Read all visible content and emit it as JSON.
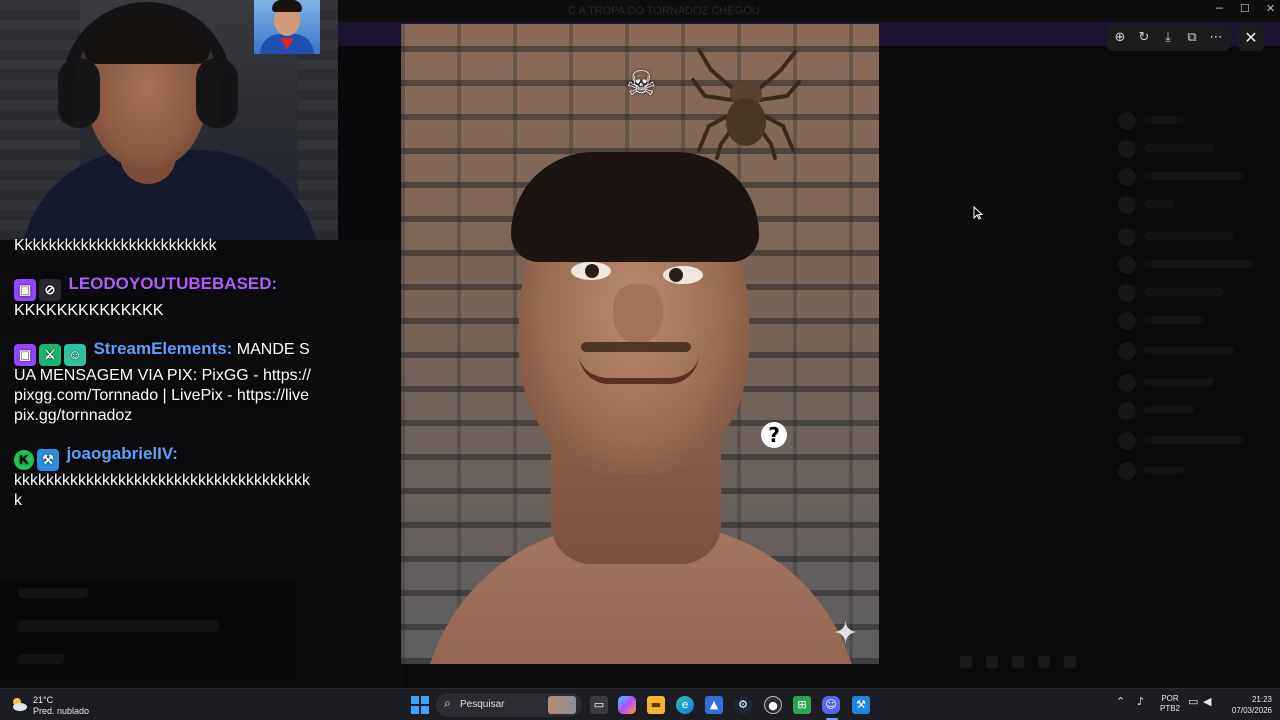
{
  "window": {
    "title": "C A TROPA DO TORNADOZ CHEGOU"
  },
  "viewer": {
    "toolbar": [
      {
        "name": "zoom-in-icon",
        "glyph": "⊕"
      },
      {
        "name": "rotate-icon",
        "glyph": "↻"
      },
      {
        "name": "download-icon",
        "glyph": "⤓"
      },
      {
        "name": "open-external-icon",
        "glyph": "⧉"
      },
      {
        "name": "more-icon",
        "glyph": "⋯"
      }
    ],
    "close_glyph": "✕",
    "stickers": {
      "skull": "☠",
      "question": "?",
      "sparkle": "✦"
    }
  },
  "chat": {
    "first_line": "Kkkkkkkkkkkkkkkkkkkkkkkkk",
    "messages": [
      {
        "badges": [
          "twitch-icon",
          "no-audio-icon"
        ],
        "user": "LEODOYOUTUBEBASED:",
        "user_color": "#b35cff",
        "text": "KKKKKKKKKKKKKK"
      },
      {
        "badges": [
          "twitch-icon",
          "moderator-icon",
          "bot-icon"
        ],
        "user": "StreamElements:",
        "user_color": "#5aa2ff",
        "text": " MANDE SUA MENSAGEM VIA PIX: PixGG - https://pixgg.com/Tornnado | LivePix - https://livepix.gg/tornnadoz"
      },
      {
        "badges": [
          "kick-icon",
          "hammer-icon"
        ],
        "user": "joaogabrielIV:",
        "user_color": "#5aa2ff",
        "text": "kkkkkkkkkkkkkkkkkkkkkkkkkkkkkkkkkkkkkk"
      }
    ]
  },
  "taskbar": {
    "weather_temp": "21°C",
    "weather_desc": "Pred. nublado",
    "search_placeholder": "Pesquisar",
    "lang_line1": "POR",
    "lang_line2": "PTB2",
    "time": "21:23",
    "date": "07/03/2026",
    "colors": {
      "accent": "#5aa9ff",
      "bg": "#1c1d22"
    }
  }
}
